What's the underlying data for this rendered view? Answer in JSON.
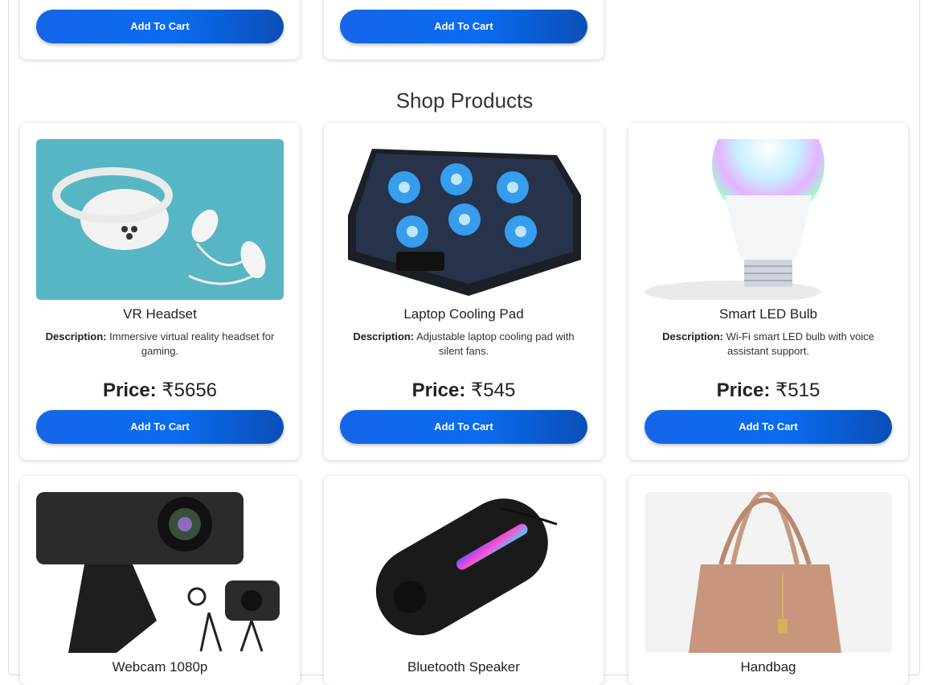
{
  "section_title": "Shop Products",
  "currency": "₹",
  "description_label": "Description:",
  "price_label": "Price:",
  "add_to_cart_label": "Add To Cart",
  "top_row": [
    {
      "button": "Add To Cart"
    },
    {
      "button": "Add To Cart"
    }
  ],
  "products": [
    {
      "name": "VR Headset",
      "description": "Immersive virtual reality headset for gaming.",
      "price": "5656"
    },
    {
      "name": "Laptop Cooling Pad",
      "description": "Adjustable laptop cooling pad with silent fans.",
      "price": "545"
    },
    {
      "name": "Smart LED Bulb",
      "description": "Wi-Fi smart LED bulb with voice assistant support.",
      "price": "515"
    }
  ],
  "bottom_row": [
    {
      "name": "Webcam 1080p"
    },
    {
      "name": "Bluetooth Speaker"
    },
    {
      "name": "Handbag"
    }
  ],
  "colors": {
    "button": "#0a6cf0",
    "accent_dark": "#0b4fb8",
    "text": "#222222"
  }
}
